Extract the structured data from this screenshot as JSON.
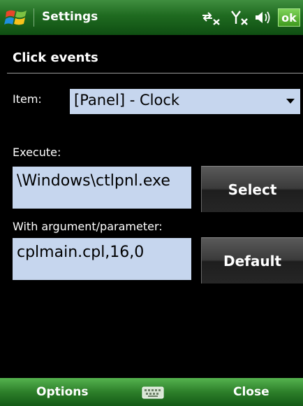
{
  "titlebar": {
    "title": "Settings",
    "ok_label": "ok",
    "icons": [
      "start-icon",
      "connectivity-icon",
      "signal-off-icon",
      "volume-icon"
    ]
  },
  "page": {
    "section_title": "Click events",
    "item_label": "Item:",
    "item_value": "[Panel] - Clock",
    "execute_label": "Execute:",
    "execute_value": "\\Windows\\ctlpnl.exe",
    "select_button": "Select",
    "argument_label": "With argument/parameter:",
    "argument_value": "cplmain.cpl,16,0",
    "default_button": "Default"
  },
  "softkeys": {
    "left": "Options",
    "right": "Close",
    "center_icon": "keyboard-icon"
  },
  "colors": {
    "bar_green": "#2d7f2a",
    "field_bg": "#c6d6ee",
    "ok_green": "#5bbf3a"
  }
}
